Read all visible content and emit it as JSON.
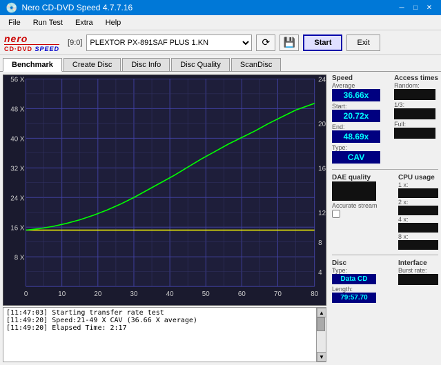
{
  "titleBar": {
    "title": "Nero CD-DVD Speed 4.7.7.16",
    "minimize": "─",
    "maximize": "□",
    "close": "✕"
  },
  "menu": {
    "items": [
      "File",
      "Run Test",
      "Extra",
      "Help"
    ]
  },
  "toolbar": {
    "driveLabel": "[9:0]",
    "driveValue": "PLEXTOR PX-891SAF PLUS 1.KN",
    "startLabel": "Start",
    "exitLabel": "Exit"
  },
  "tabs": {
    "items": [
      "Benchmark",
      "Create Disc",
      "Disc Info",
      "Disc Quality",
      "ScanDisc"
    ],
    "active": 0
  },
  "chart": {
    "yAxisLabels": [
      "56 X",
      "48 X",
      "40 X",
      "32 X",
      "24 X",
      "16 X",
      "8 X",
      ""
    ],
    "yAxisRight": [
      "24",
      "20",
      "16",
      "12",
      "8",
      "4",
      ""
    ],
    "xAxisLabels": [
      "0",
      "10",
      "20",
      "30",
      "40",
      "50",
      "60",
      "70",
      "80"
    ]
  },
  "speedPanel": {
    "sectionLabel": "Speed",
    "averageLabel": "Average",
    "averageValue": "36.66x",
    "startLabel": "Start:",
    "startValue": "20.72x",
    "endLabel": "End:",
    "endValue": "48.69x",
    "typeLabel": "Type:",
    "typeValue": "CAV"
  },
  "accessTimesPanel": {
    "sectionLabel": "Access times",
    "randomLabel": "Random:",
    "randomValue": "",
    "oneThirdLabel": "1/3:",
    "oneThirdValue": "",
    "fullLabel": "Full:",
    "fullValue": ""
  },
  "cpuPanel": {
    "sectionLabel": "CPU usage",
    "label1x": "1 x:",
    "value1x": "",
    "label2x": "2 x:",
    "value2x": "",
    "label4x": "4 x:",
    "value4x": "",
    "label8x": "8 x:",
    "value8x": ""
  },
  "daePanel": {
    "sectionLabel": "DAE quality",
    "value": "",
    "accurateStreamLabel": "Accurate stream",
    "accurateStreamChecked": false
  },
  "discPanel": {
    "sectionLabel": "Disc",
    "typeLabel": "Type:",
    "typeValue": "Data CD",
    "lengthLabel": "Length:",
    "lengthValue": "79:57.70"
  },
  "interfacePanel": {
    "sectionLabel": "Interface",
    "burstLabel": "Burst rate:",
    "burstValue": ""
  },
  "log": {
    "lines": [
      "[11:47:03]  Starting transfer rate test",
      "[11:49:20]  Speed:21-49 X CAV (36.66 X average)",
      "[11:49:20]  Elapsed Time: 2:17"
    ]
  }
}
